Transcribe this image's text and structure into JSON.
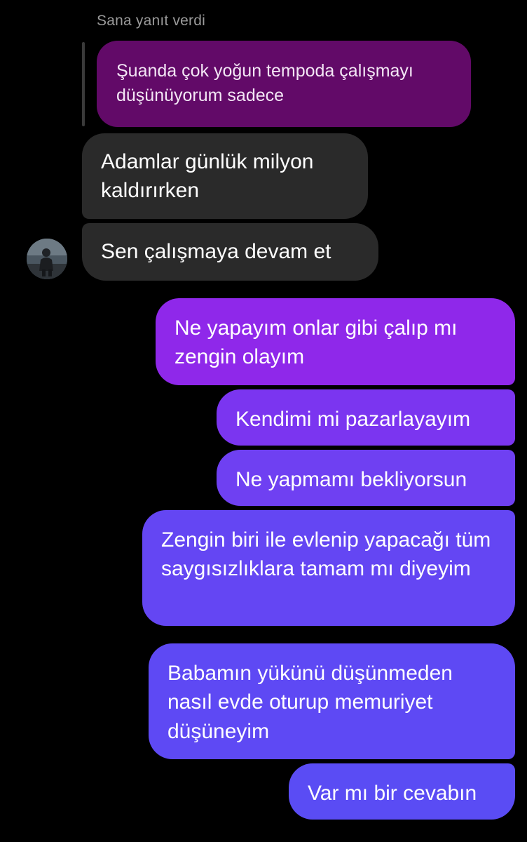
{
  "conversation": {
    "reply_context": {
      "label": "Sana yanıt verdi",
      "quoted_message": "Şuanda çok yoğun tempoda çalışmayı düşünüyorum sadece"
    },
    "incoming_messages": [
      {
        "text": "Adamlar günlük milyon kaldırırken"
      },
      {
        "text": "Sen çalışmaya devam et"
      }
    ],
    "outgoing_messages": [
      {
        "text": "Ne yapayım onlar gibi çalıp mı zengin olayım"
      },
      {
        "text": "Kendimi mi pazarlayayım"
      },
      {
        "text": "Ne yapmamı bekliyorsun"
      },
      {
        "text": "Zengin biri ile evlenip yapacağı tüm saygısızlıklara tamam mı diyeyim"
      },
      {
        "text": "Babamın yükünü düşünmeden nasıl evde oturup memuriyet düşüneyim"
      },
      {
        "text": "Var mı bir cevabın"
      }
    ]
  },
  "colors": {
    "background": "#000000",
    "quoted_bubble": "#620a68",
    "incoming_bubble": "#2a2a2a",
    "outgoing_gradient_top": "#8f28ea",
    "outgoing_gradient_bottom": "#5a4cf4"
  },
  "icons": {
    "avatar": "contact-profile-photo"
  }
}
